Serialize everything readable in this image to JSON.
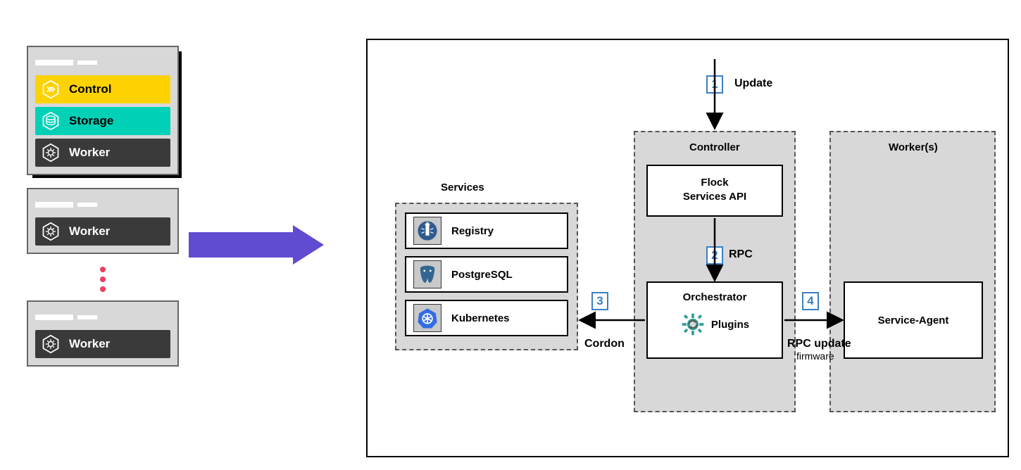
{
  "left": {
    "nodes": {
      "control": "Control",
      "storage": "Storage",
      "worker": "Worker"
    }
  },
  "services": {
    "title": "Services",
    "items": [
      {
        "name": "Registry"
      },
      {
        "name": "PostgreSQL"
      },
      {
        "name": "Kubernetes"
      }
    ]
  },
  "controller": {
    "title": "Controller",
    "flock_l1": "Flock",
    "flock_l2": "Services API",
    "orchestrator": "Orchestrator",
    "plugins": "Plugins"
  },
  "workers": {
    "title": "Worker(s)",
    "service_agent": "Service-Agent"
  },
  "steps": {
    "s1": "1",
    "s1_label": "Update",
    "s2": "2",
    "s2_label": "RPC",
    "s3": "3",
    "s3_label": "Cordon",
    "s4": "4",
    "s4_label": "RPC update",
    "s4_sub": "firmware"
  }
}
